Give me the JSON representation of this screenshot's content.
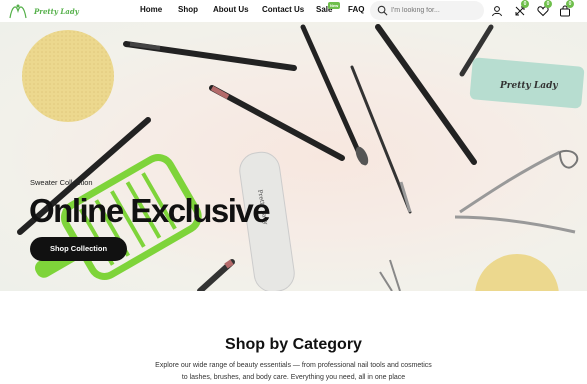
{
  "brand": {
    "name": "Pretty Lady",
    "accent": "#6fbf4c"
  },
  "nav": {
    "items": [
      "Home",
      "Shop",
      "About Us",
      "Contact Us",
      "Sale",
      "FAQ"
    ],
    "sale_badge": "New"
  },
  "search": {
    "placeholder": "I'm looking for..."
  },
  "header_icons": {
    "wishlist_count": "0",
    "cart_count": "0",
    "compare_count": "0"
  },
  "hero": {
    "subtitle": "Sweater Collection",
    "title": "Online Exclusive",
    "button": "Shop Collection"
  },
  "category": {
    "title": "Shop by Category",
    "description_line1": "Explore our wide range of beauty essentials — from professional nail tools and cosmetics",
    "description_line2": "to lashes, brushes, and body care. Everything you need, all in one place"
  }
}
